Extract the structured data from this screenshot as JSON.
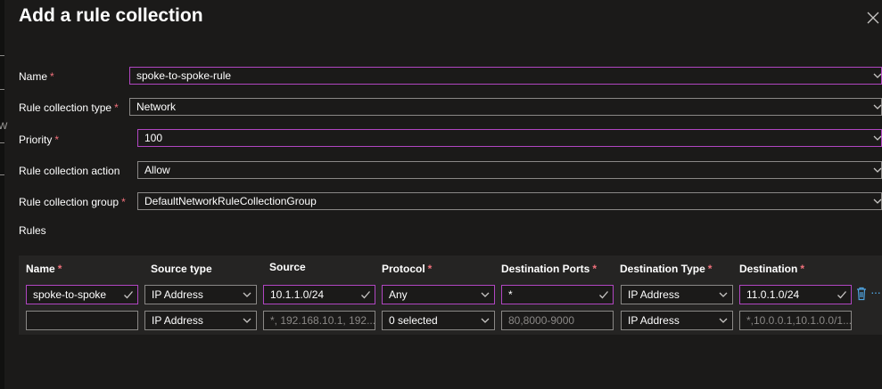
{
  "panel": {
    "title": "Add a rule collection",
    "close_icon": "close-icon",
    "edge_glyph": "W"
  },
  "form": {
    "required_mark": "*",
    "name": {
      "label": "Name",
      "value": "spoke-to-spoke-rule"
    },
    "type": {
      "label": "Rule collection type",
      "value": "Network"
    },
    "priority": {
      "label": "Priority",
      "value": "100"
    },
    "action": {
      "label": "Rule collection action",
      "value": "Allow"
    },
    "group": {
      "label": "Rule collection group",
      "value": "DefaultNetworkRuleCollectionGroup"
    }
  },
  "rules": {
    "label": "Rules",
    "columns": [
      {
        "label": "Name",
        "required": true
      },
      {
        "label": "Source type",
        "required": false
      },
      {
        "label": "Source",
        "required": false
      },
      {
        "label": "Protocol",
        "required": true
      },
      {
        "label": "Destination Ports",
        "required": true
      },
      {
        "label": "Destination Type",
        "required": true
      },
      {
        "label": "Destination",
        "required": true
      }
    ],
    "rows": [
      {
        "name": "spoke-to-spoke",
        "source_type": "IP Address",
        "source": "10.1.1.0/24",
        "protocol": "Any",
        "dest_ports": "*",
        "dest_type": "IP Address",
        "destination": "11.0.1.0/24"
      },
      {
        "name": "",
        "source_type": "IP Address",
        "source_placeholder": "*, 192.168.10.1, 192...",
        "protocol": "0 selected",
        "dest_ports_placeholder": "80,8000-9000",
        "dest_type": "IP Address",
        "destination_placeholder": "*,10.0.0.1,10.1.0.0/1..."
      }
    ],
    "row_actions": {
      "delete_icon": "trash-icon",
      "more_icon": "ellipsis-icon",
      "more_text": "···"
    }
  },
  "colors": {
    "accent": "#b146c2",
    "required": "#f1707b",
    "link": "#4fa3e0",
    "background": "#1b1a19"
  }
}
